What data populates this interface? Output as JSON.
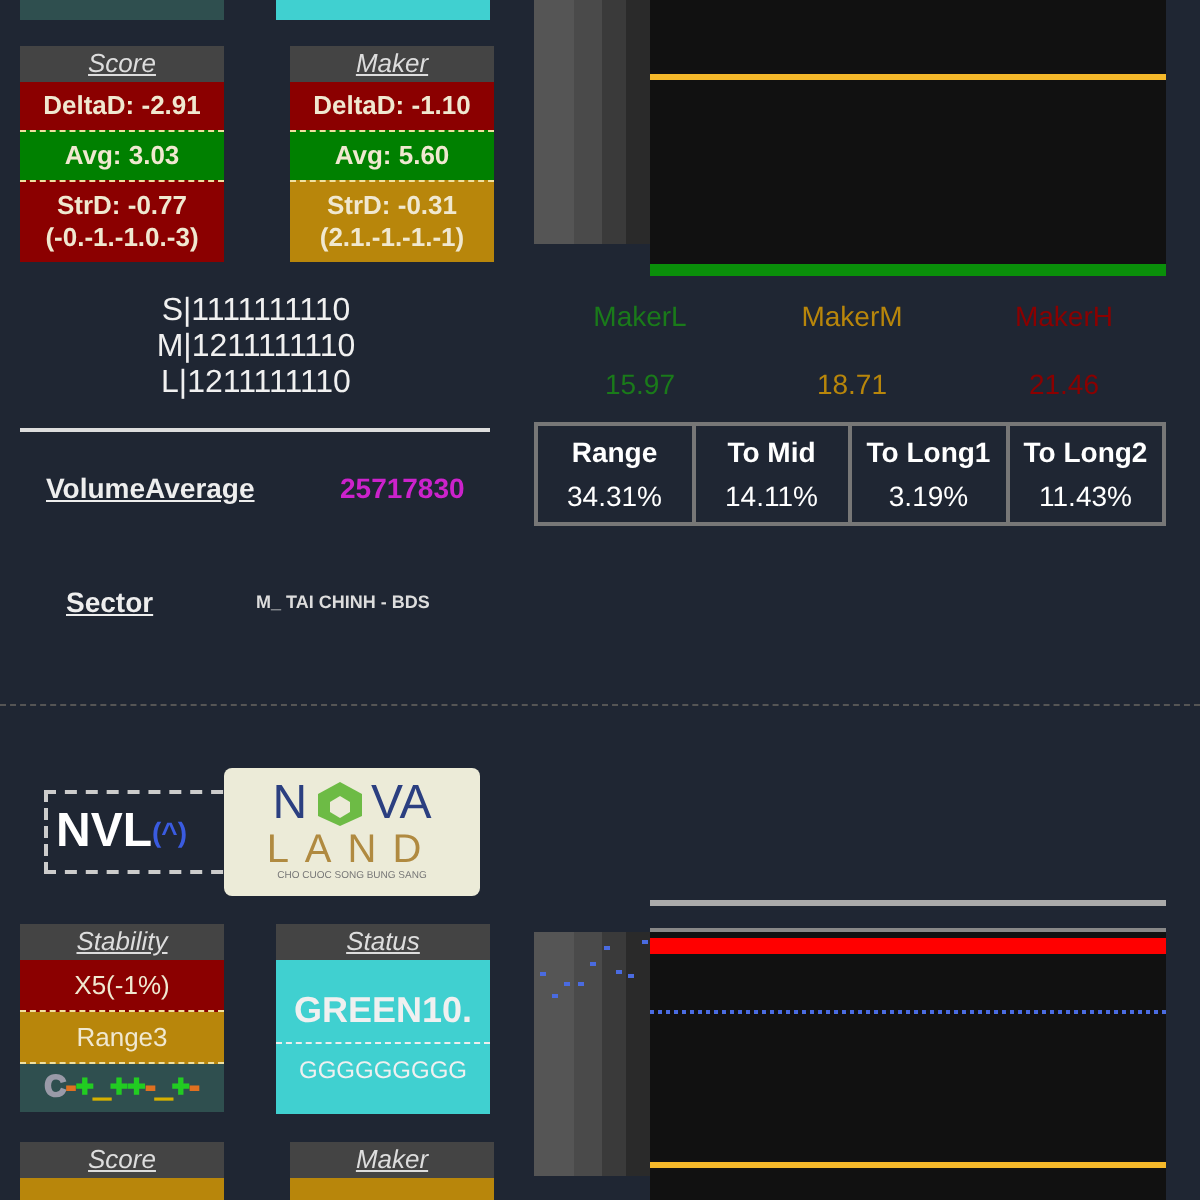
{
  "section_1": {
    "cards": [
      {
        "title": "Score",
        "rows": [
          {
            "text": "DeltaD: -2.91",
            "color": "#8b0000"
          },
          {
            "text": "Avg: 3.03",
            "color": "#008000"
          },
          {
            "text": "StrD: -0.77",
            "sub": "(-0.-1.-1.0.-3)",
            "color": "#8b0000"
          }
        ]
      },
      {
        "title": "Maker",
        "rows": [
          {
            "text": "DeltaD: -1.10",
            "color": "#8b0000"
          },
          {
            "text": "Avg: 5.60",
            "color": "#008000"
          },
          {
            "text": "StrD: -0.31",
            "sub": "(2.1.-1.-1.-1)",
            "color": "#b8860b"
          }
        ]
      }
    ],
    "signals": [
      "S|1111111110",
      "M|1211111110",
      "L|1211111110"
    ],
    "volume": {
      "label": "VolumeAverage",
      "value": "25717830"
    },
    "sector": {
      "label": "Sector",
      "value": "M_ TAI CHINH - BDS"
    },
    "makers": [
      {
        "label": "MakerL",
        "value": "15.97",
        "color": "#1a7a1a"
      },
      {
        "label": "MakerM",
        "value": "18.71",
        "color": "#b8860b"
      },
      {
        "label": "MakerH",
        "value": "21.46",
        "color": "#8b0000"
      }
    ],
    "stats": [
      {
        "label": "Range",
        "value": "34.31%"
      },
      {
        "label": "To Mid",
        "value": "14.11%"
      },
      {
        "label": "To Long1",
        "value": "3.19%"
      },
      {
        "label": "To Long2",
        "value": "11.43%"
      }
    ]
  },
  "section_2": {
    "ticker": "NVL",
    "badge": "(^)",
    "logo": {
      "left": "N",
      "right": "VA",
      "line2": "LAND",
      "tagline": "CHO CUOC SONG BUNG SANG"
    },
    "stability": {
      "title": "Stability",
      "rows": [
        {
          "text": "X5(-1%)",
          "color": "#8b0000"
        },
        {
          "text": "Range3",
          "color": "#b8860b"
        }
      ],
      "pattern": [
        {
          "char": "C",
          "color": "#9a9aa8"
        },
        {
          "char": "-",
          "color": "#e07020"
        },
        {
          "char": "+",
          "color": "#22cc22"
        },
        {
          "char": "_",
          "color": "#d4b000"
        },
        {
          "char": "++",
          "color": "#22cc22"
        },
        {
          "char": "-",
          "color": "#e07020"
        },
        {
          "char": "_",
          "color": "#d4b000"
        },
        {
          "char": "+",
          "color": "#22cc22"
        },
        {
          "char": "-",
          "color": "#e07020"
        }
      ]
    },
    "status": {
      "title": "Status",
      "main": "GREEN10.",
      "sub": "GGGGGGGGG"
    },
    "cards": [
      {
        "title": "Score",
        "color": "#b8860b"
      },
      {
        "title": "Maker",
        "color": "#b8860b"
      }
    ]
  }
}
